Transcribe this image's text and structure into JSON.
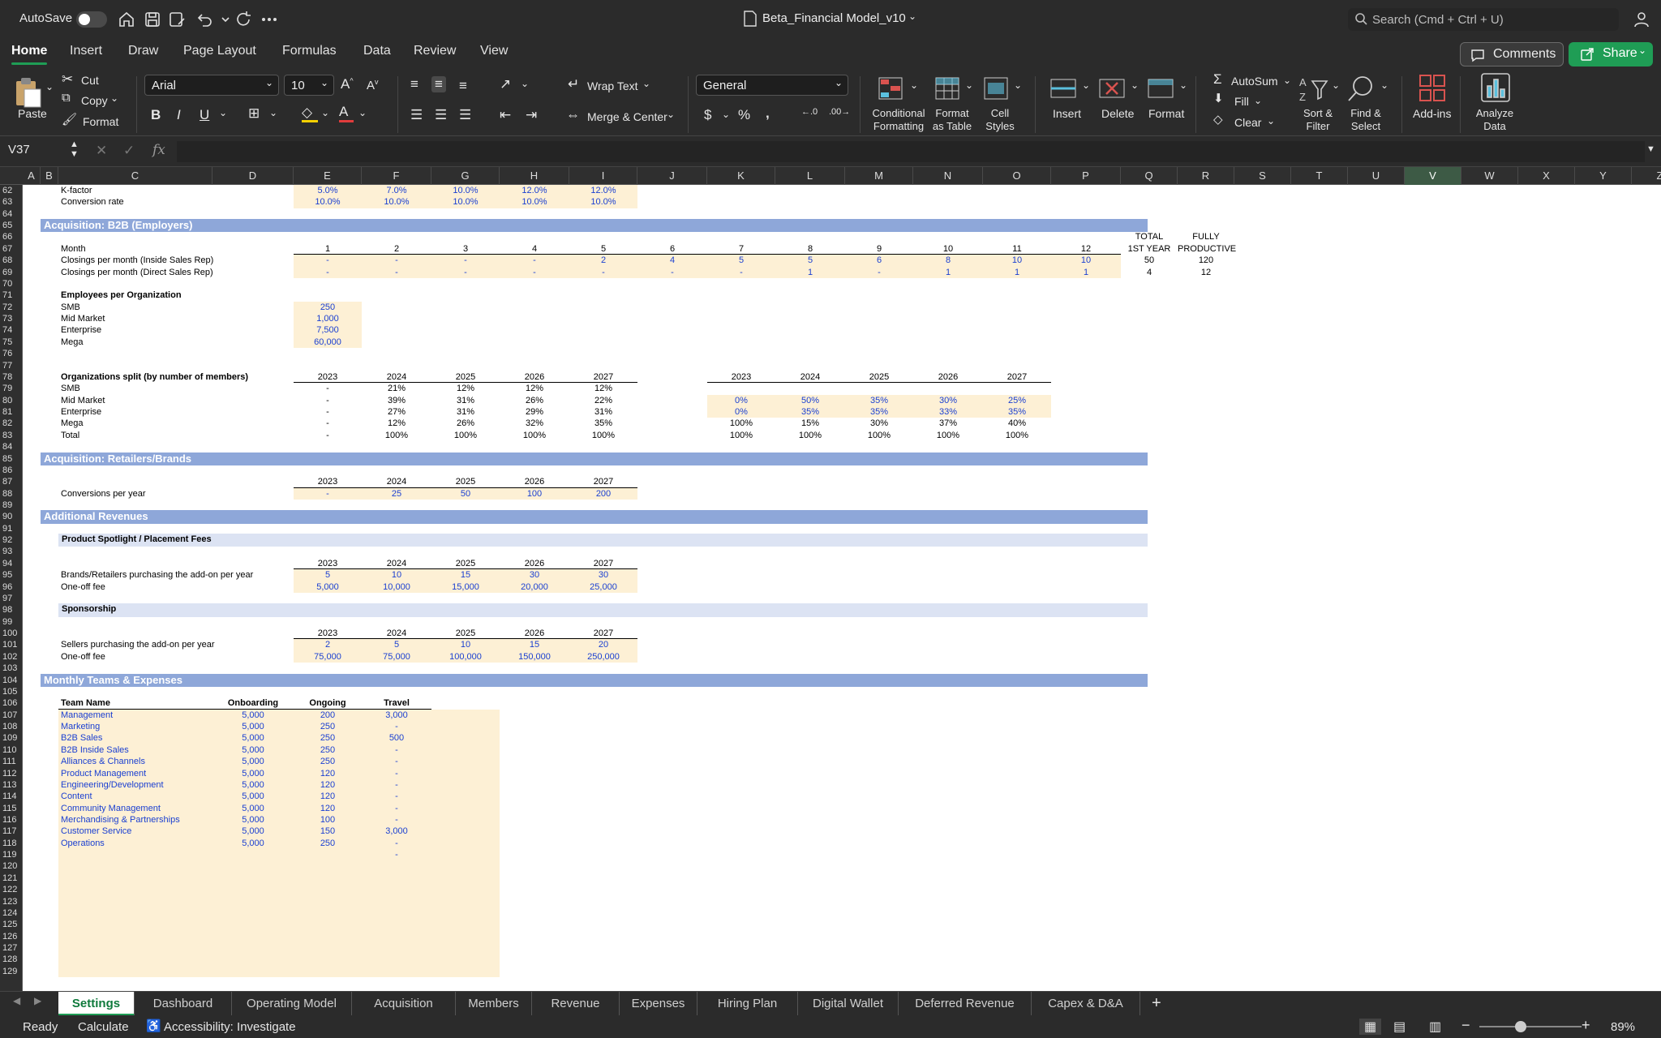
{
  "titlebar": {
    "autosave_label": "AutoSave",
    "doc_title": "Beta_Financial Model_v10",
    "search_placeholder": "Search (Cmd + Ctrl + U)"
  },
  "tabs": [
    "Home",
    "Insert",
    "Draw",
    "Page Layout",
    "Formulas",
    "Data",
    "Review",
    "View"
  ],
  "comments_label": "Comments",
  "share_label": "Share",
  "ribbon": {
    "paste": "Paste",
    "cut": "Cut",
    "copy": "Copy",
    "format": "Format",
    "font_name": "Arial",
    "font_size": "10",
    "wrap_text": "Wrap Text",
    "merge_center": "Merge & Center",
    "number_format": "General",
    "cond_fmt": [
      "Conditional",
      "Formatting"
    ],
    "fmt_table": [
      "Format",
      "as Table"
    ],
    "cell_styles": [
      "Cell",
      "Styles"
    ],
    "insert": "Insert",
    "delete": "Delete",
    "format_cells": "Format",
    "autosum": "AutoSum",
    "fill": "Fill",
    "clear": "Clear",
    "sort_filter": [
      "Sort &",
      "Filter"
    ],
    "find_select": [
      "Find &",
      "Select"
    ],
    "addins": "Add-ins",
    "analyze": [
      "Analyze",
      "Data"
    ]
  },
  "namebox": "V37",
  "columns": [
    "A",
    "B",
    "C",
    "D",
    "E",
    "F",
    "G",
    "H",
    "I",
    "J",
    "K",
    "L",
    "M",
    "N",
    "O",
    "P",
    "Q",
    "R",
    "S",
    "T",
    "U",
    "V",
    "W",
    "X",
    "Y",
    "Z"
  ],
  "selected_column": "V",
  "rows": [
    62,
    63,
    64,
    65,
    66,
    67,
    68,
    69,
    70,
    71,
    72,
    73,
    74,
    75,
    76,
    77,
    78,
    79,
    80,
    81,
    82,
    83,
    84,
    85,
    86,
    87,
    88,
    89,
    90,
    91,
    92,
    93,
    94,
    95,
    96,
    97,
    98,
    99,
    100,
    101,
    102,
    103,
    104,
    105,
    106,
    107,
    108,
    109,
    110,
    111,
    112,
    113,
    114,
    115,
    116,
    117,
    118,
    119,
    120,
    121,
    122,
    123,
    124,
    125,
    126,
    127,
    128,
    129
  ],
  "sheet": {
    "kfactor": {
      "label": "K-factor",
      "values": [
        "5.0%",
        "7.0%",
        "10.0%",
        "12.0%",
        "12.0%"
      ]
    },
    "conversion": {
      "label": "Conversion rate",
      "values": [
        "10.0%",
        "10.0%",
        "10.0%",
        "10.0%",
        "10.0%"
      ]
    },
    "b2b_title": "Acquisition: B2B (Employers)",
    "total_hdr": [
      "TOTAL",
      "1ST YEAR"
    ],
    "fully_hdr": [
      "FULLY",
      "PRODUCTIVE"
    ],
    "month_label": "Month",
    "months": [
      "1",
      "2",
      "3",
      "4",
      "5",
      "6",
      "7",
      "8",
      "9",
      "10",
      "11",
      "12"
    ],
    "closings_inside": {
      "label": "Closings per month (Inside Sales Rep)",
      "values": [
        "-",
        "-",
        "-",
        "-",
        "2",
        "4",
        "5",
        "5",
        "6",
        "8",
        "10",
        "10"
      ],
      "total": "50",
      "full": "120"
    },
    "closings_direct": {
      "label": "Closings per month (Direct Sales Rep)",
      "values": [
        "-",
        "-",
        "-",
        "-",
        "-",
        "-",
        "-",
        "1",
        "-",
        "1",
        "1",
        "1"
      ],
      "total": "4",
      "full": "12"
    },
    "emp_title": "Employees per Organization",
    "employees": [
      {
        "label": "SMB",
        "value": "250"
      },
      {
        "label": "Mid Market",
        "value": "1,000"
      },
      {
        "label": "Enterprise",
        "value": "7,500"
      },
      {
        "label": "Mega",
        "value": "60,000"
      }
    ],
    "org_title": "Organizations split (by number of members)",
    "years": [
      "2023",
      "2024",
      "2025",
      "2026",
      "2027"
    ],
    "org_left": [
      {
        "label": "SMB",
        "values": [
          "-",
          "21%",
          "12%",
          "12%",
          "12%"
        ]
      },
      {
        "label": "Mid Market",
        "values": [
          "-",
          "39%",
          "31%",
          "26%",
          "22%"
        ]
      },
      {
        "label": "Enterprise",
        "values": [
          "-",
          "27%",
          "31%",
          "29%",
          "31%"
        ]
      },
      {
        "label": "Mega",
        "values": [
          "-",
          "12%",
          "26%",
          "32%",
          "35%"
        ]
      },
      {
        "label": "Total",
        "values": [
          "-",
          "100%",
          "100%",
          "100%",
          "100%"
        ]
      }
    ],
    "org_right": [
      {
        "values": [
          "0%",
          "50%",
          "35%",
          "30%",
          "25%"
        ]
      },
      {
        "values": [
          "0%",
          "35%",
          "35%",
          "33%",
          "35%"
        ]
      },
      {
        "values": [
          "100%",
          "15%",
          "30%",
          "37%",
          "40%"
        ]
      },
      {
        "values": [
          "100%",
          "100%",
          "100%",
          "100%",
          "100%"
        ]
      }
    ],
    "retail_title": "Acquisition: Retailers/Brands",
    "conversions_year": {
      "label": "Conversions per year",
      "values": [
        "-",
        "25",
        "50",
        "100",
        "200"
      ]
    },
    "addrev_title": "Additional Revenues",
    "spotlight_title": "Product Spotlight / Placement Fees",
    "spot_brands": {
      "label": "Brands/Retailers purchasing the add-on per year",
      "values": [
        "5",
        "10",
        "15",
        "30",
        "30"
      ]
    },
    "spot_fee": {
      "label": "One-off fee",
      "values": [
        "5,000",
        "10,000",
        "15,000",
        "20,000",
        "25,000"
      ]
    },
    "sponsor_title": "Sponsorship",
    "spon_sellers": {
      "label": "Sellers purchasing the add-on per year",
      "values": [
        "2",
        "5",
        "10",
        "15",
        "20"
      ]
    },
    "spon_fee": {
      "label": "One-off fee",
      "values": [
        "75,000",
        "75,000",
        "100,000",
        "150,000",
        "250,000"
      ]
    },
    "teams_title": "Monthly Teams & Expenses",
    "teams_hdr": [
      "Team Name",
      "Onboarding",
      "Ongoing",
      "Travel"
    ],
    "teams": [
      [
        "Management",
        "5,000",
        "200",
        "3,000"
      ],
      [
        "Marketing",
        "5,000",
        "250",
        "-"
      ],
      [
        "B2B Sales",
        "5,000",
        "250",
        "500"
      ],
      [
        "B2B Inside Sales",
        "5,000",
        "250",
        "-"
      ],
      [
        "Alliances & Channels",
        "5,000",
        "250",
        "-"
      ],
      [
        "Product Management",
        "5,000",
        "120",
        "-"
      ],
      [
        "Engineering/Development",
        "5,000",
        "120",
        "-"
      ],
      [
        "Content",
        "5,000",
        "120",
        "-"
      ],
      [
        "Community Management",
        "5,000",
        "120",
        "-"
      ],
      [
        "Merchandising & Partnerships",
        "5,000",
        "100",
        "-"
      ],
      [
        "Customer Service",
        "5,000",
        "150",
        "3,000"
      ],
      [
        "Operations",
        "5,000",
        "250",
        "-"
      ]
    ],
    "extra_travel": "-"
  },
  "sheet_tabs": [
    "Settings",
    "Dashboard",
    "Operating Model",
    "Acquisition",
    "Members",
    "Revenue",
    "Expenses",
    "Hiring Plan",
    "Digital Wallet",
    "Deferred Revenue",
    "Capex & D&A"
  ],
  "active_sheet": "Settings",
  "status": {
    "ready": "Ready",
    "calculate": "Calculate",
    "accessibility": "Accessibility: Investigate",
    "zoom": "89%"
  }
}
